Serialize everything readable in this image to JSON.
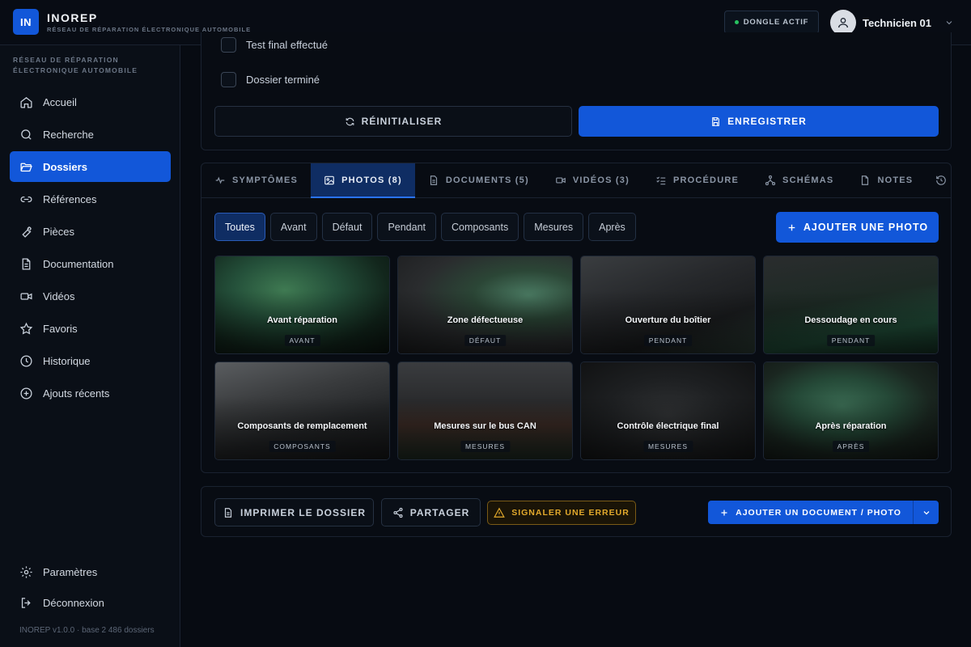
{
  "header": {
    "logo": "IN",
    "brand": "INOREP",
    "subtitle": "RÉSEAU DE RÉPARATION ÉLECTRONIQUE AUTOMOBILE",
    "dongle_status": "DONGLE ACTIF",
    "user_name": "Technicien 01"
  },
  "sidebar": {
    "section_title_line1": "RÉSEAU DE RÉPARATION",
    "section_title_line2": "ÉLECTRONIQUE AUTOMOBILE",
    "items": [
      {
        "label": "Accueil",
        "icon": "home-icon"
      },
      {
        "label": "Recherche",
        "icon": "search-icon"
      },
      {
        "label": "Dossiers",
        "icon": "folder-open-icon",
        "active": true
      },
      {
        "label": "Références",
        "icon": "link-icon"
      },
      {
        "label": "Pièces",
        "icon": "wrench-icon"
      },
      {
        "label": "Documentation",
        "icon": "document-icon"
      },
      {
        "label": "Vidéos",
        "icon": "video-icon"
      },
      {
        "label": "Favoris",
        "icon": "star-icon"
      },
      {
        "label": "Historique",
        "icon": "clock-icon"
      },
      {
        "label": "Ajouts récents",
        "icon": "plus-circle-icon"
      }
    ],
    "settings": "Paramètres",
    "logout": "Déconnexion",
    "version": "INOREP v1.0.0 · base 2 486 dossiers"
  },
  "checklist": {
    "item_partial": "Test final effectué",
    "item_done": "Dossier terminé"
  },
  "form_actions": {
    "reset": "RÉINITIALISER",
    "save": "ENREGISTRER"
  },
  "tabs": [
    {
      "label": "SYMPTÔMES",
      "icon": "pulse-icon"
    },
    {
      "label": "PHOTOS (8)",
      "icon": "image-icon",
      "active": true
    },
    {
      "label": "DOCUMENTS (5)",
      "icon": "document-icon"
    },
    {
      "label": "VIDÉOS (3)",
      "icon": "video-icon"
    },
    {
      "label": "PROCÉDURE",
      "icon": "checklist-icon"
    },
    {
      "label": "SCHÉMAS",
      "icon": "diagram-icon"
    },
    {
      "label": "NOTES",
      "icon": "note-icon"
    }
  ],
  "filters": [
    "Toutes",
    "Avant",
    "Défaut",
    "Pendant",
    "Composants",
    "Mesures",
    "Après"
  ],
  "add_photo": "AJOUTER UNE PHOTO",
  "photos": [
    {
      "title": "Avant réparation",
      "tag": "AVANT"
    },
    {
      "title": "Zone défectueuse",
      "tag": "DÉFAUT"
    },
    {
      "title": "Ouverture du boîtier",
      "tag": "PENDANT"
    },
    {
      "title": "Dessoudage en cours",
      "tag": "PENDANT"
    },
    {
      "title": "Composants de remplacement",
      "tag": "COMPOSANTS"
    },
    {
      "title": "Mesures sur le bus CAN",
      "tag": "MESURES"
    },
    {
      "title": "Contrôle électrique final",
      "tag": "MESURES"
    },
    {
      "title": "Après réparation",
      "tag": "APRÈS"
    }
  ],
  "bottom_actions": {
    "print": "IMPRIMER LE DOSSIER",
    "share": "PARTAGER",
    "report": "SIGNALER UNE ERREUR",
    "add_doc": "AJOUTER UN DOCUMENT / PHOTO"
  },
  "colors": {
    "accent": "#1257d9",
    "background": "#070b12",
    "status_ok": "#27c260",
    "warning": "#e2a92c"
  }
}
